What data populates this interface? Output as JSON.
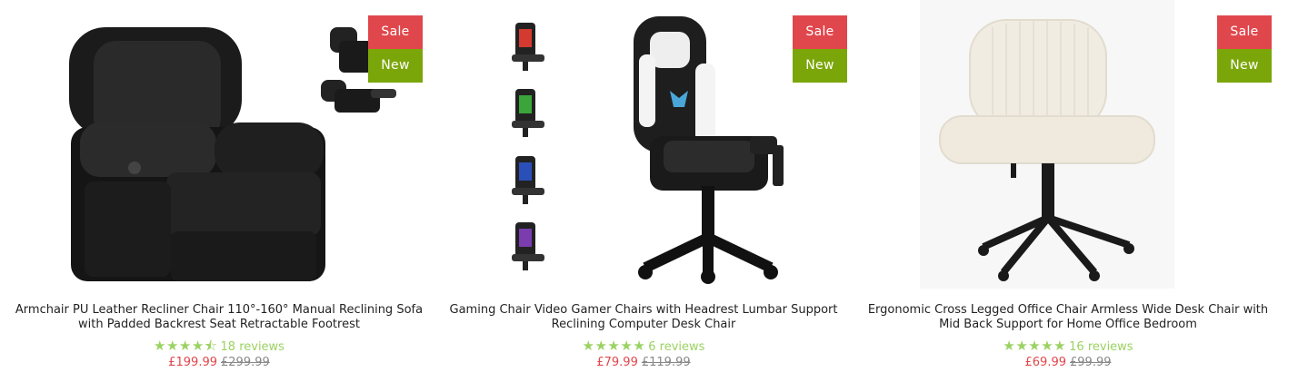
{
  "products": [
    {
      "title": "Armchair PU Leather Recliner Chair 110°-160° Manual Reclining Sofa with Padded Backrest Seat Retractable Footrest",
      "badges": {
        "sale": "Sale",
        "new": "New"
      },
      "stars": "★★★★⯪",
      "reviews": "18 reviews",
      "price_now": "£199.99",
      "price_was": "£299.99",
      "image_icon": "recliner-chair-image"
    },
    {
      "title": "Gaming Chair Video Gamer Chairs with Headrest Lumbar Support Reclining Computer Desk Chair",
      "badges": {
        "sale": "Sale",
        "new": "New"
      },
      "stars": "★★★★★",
      "reviews": "6 reviews",
      "price_now": "£79.99",
      "price_was": "£119.99",
      "image_icon": "gaming-chair-image"
    },
    {
      "title": "Ergonomic Cross Legged Office Chair Armless Wide Desk Chair with Mid Back Support for Home Office Bedroom",
      "badges": {
        "sale": "Sale",
        "new": "New"
      },
      "stars": "★★★★★",
      "reviews": "16 reviews",
      "price_now": "£69.99",
      "price_was": "£99.99",
      "image_icon": "office-chair-image"
    }
  ],
  "colors": {
    "sale": "#e0474c",
    "new": "#7ba60a",
    "stars": "#9bd262",
    "price_now": "#e0474c",
    "price_was": "#888888"
  }
}
